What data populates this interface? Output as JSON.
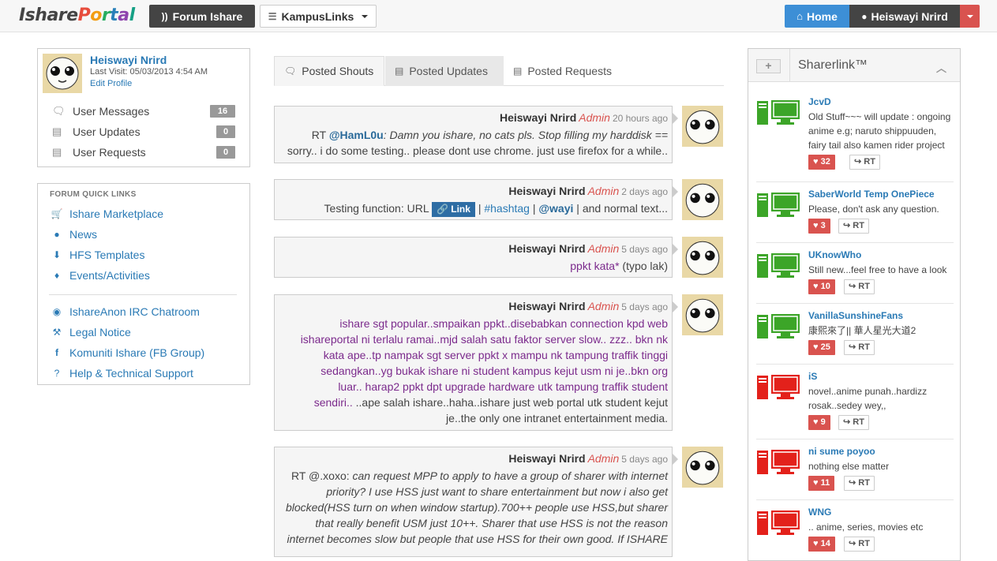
{
  "navbar": {
    "logo": "IsharePortal",
    "forum_label": "Forum Ishare",
    "kampus_label": "KampusLinks",
    "home_label": "Home",
    "user_label": "Heiswayi Nrird"
  },
  "profile": {
    "name": "Heiswayi Nrird",
    "last_visit": "Last Visit: 05/03/2013 4:54 AM",
    "edit_label": "Edit Profile",
    "items": [
      {
        "label": "User Messages",
        "count": "16",
        "icon": "comments-icon"
      },
      {
        "label": "User Updates",
        "count": "0",
        "icon": "list-icon"
      },
      {
        "label": "User Requests",
        "count": "0",
        "icon": "list-icon"
      }
    ]
  },
  "quick_links": {
    "title": "FORUM QUICK LINKS",
    "items": [
      {
        "label": "Ishare Marketplace",
        "icon": "cart-icon"
      },
      {
        "label": "News",
        "icon": "globe-icon"
      },
      {
        "label": "HFS Templates",
        "icon": "download-icon"
      },
      {
        "label": "Events/Activities",
        "icon": "fire-icon"
      },
      {
        "label": "IshareAnon IRC Chatroom",
        "icon": "eye-icon"
      },
      {
        "label": "Legal Notice",
        "icon": "gavel-icon"
      },
      {
        "label": "Komuniti Ishare (FB Group)",
        "icon": "facebook-icon"
      },
      {
        "label": "Help & Technical Support",
        "icon": "question-icon"
      }
    ]
  },
  "tabs": [
    {
      "label": "Posted Shouts"
    },
    {
      "label": "Posted Updates"
    },
    {
      "label": "Posted Requests"
    }
  ],
  "shouts": [
    {
      "author": "Heiswayi Nrird",
      "role": "Admin",
      "time": "20 hours ago",
      "prefix": "RT",
      "mention": "@HamL0u",
      "text": ": Damn you ishare, no cats pls. Stop filling my harddisk ==",
      "line2": "sorry.. i do some testing.. please dont use chrome. just use firefox for a while.."
    },
    {
      "author": "Heiswayi Nrird",
      "role": "Admin",
      "time": "2 days ago",
      "text_a": "Testing function: URL",
      "link_label": "Link",
      "sep1": "|",
      "hashtag": "#hashtag",
      "sep2": "|",
      "mention": "@wayi",
      "text_b": "| and normal text..."
    },
    {
      "author": "Heiswayi Nrird",
      "role": "Admin",
      "time": "5 days ago",
      "purple": "ppkt kata*",
      "text": " (typo lak)"
    },
    {
      "author": "Heiswayi Nrird",
      "role": "Admin",
      "time": "5 days ago",
      "purple": "ishare sgt popular..smpaikan ppkt..disebabkan connection kpd web ishareportal ni terlalu ramai..mjd salah satu faktor server slow.. zzz.. bkn nk kata ape..tp nampak sgt server ppkt x mampu nk tampung traffik tinggi sedangkan..yg bukak ishare ni student kampus kejut usm ni je..bkn org luar.. harap2 ppkt dpt upgrade hardware utk tampung traffik student sendiri..",
      "text": " ..ape salah ishare..haha..ishare just web portal utk student kejut je..the only one intranet entertainment media."
    },
    {
      "author": "Heiswayi Nrird",
      "role": "Admin",
      "time": "5 days ago",
      "prefix": "RT @.xoxo:",
      "text": " can request MPP to apply to have a group of sharer with internet priority? I use HSS just want to share entertainment but now i also get blocked(HSS turn on when window startup).700++ people use HSS,but sharer that really benefit USM just 10++. Sharer that use HSS is not the reason internet becomes slow but people that use HSS for their own good. If ISHARE"
    }
  ],
  "sharerlink": {
    "title": "Sharerlink™",
    "plus": "+",
    "items": [
      {
        "name": "JcvD",
        "desc": "Old Stuff~~~ will update : ongoing anime e.g; naruto shippuuden, fairy tail also kamen rider project",
        "likes": "32",
        "rt": "RT",
        "status": "online",
        "color": "#3ca528"
      },
      {
        "name": "SaberWorld Temp OnePiece",
        "desc": "Please, don't ask any question.",
        "likes": "3",
        "rt": "RT",
        "status": "online",
        "color": "#3ca528"
      },
      {
        "name": "UKnowWho",
        "desc": "Still new...feel free to have a look",
        "likes": "10",
        "rt": "RT",
        "status": "online",
        "color": "#3ca528"
      },
      {
        "name": "VanillaSunshineFans",
        "desc": "康熙來了|| 華人星光大道2",
        "likes": "25",
        "rt": "RT",
        "status": "online",
        "color": "#3ca528"
      },
      {
        "name": "iS",
        "desc": "novel..anime punah..hardizz rosak..sedey wey,,",
        "likes": "9",
        "rt": "RT",
        "status": "offline",
        "color": "#e3211b"
      },
      {
        "name": "ni sume poyoo",
        "desc": "nothing else matter",
        "likes": "11",
        "rt": "RT",
        "status": "offline",
        "color": "#e3211b"
      },
      {
        "name": "WNG",
        "desc": ".. anime, series, movies etc",
        "likes": "14",
        "rt": "RT",
        "status": "offline",
        "color": "#e3211b"
      }
    ]
  }
}
